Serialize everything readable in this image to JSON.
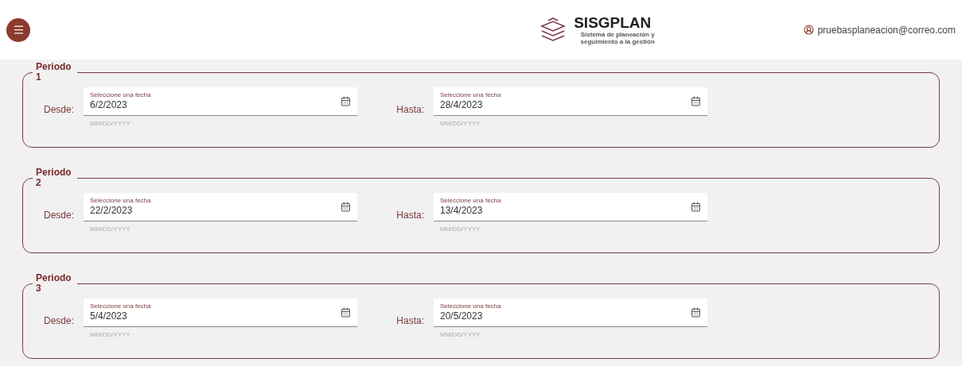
{
  "header": {
    "app_name": "SISGPLAN",
    "app_subtitle": "Sistema de planeación y seguimiento a la gestión",
    "user_email": "pruebasplaneacion@correo.com"
  },
  "periods": [
    {
      "legend": "Periodo 1",
      "from": {
        "label": "Desde:",
        "floating_label": "Seleccione una fecha",
        "value": "6/2/2023",
        "helper": "MM/DD/YYYY"
      },
      "to": {
        "label": "Hasta:",
        "floating_label": "Seleccione una fecha",
        "value": "28/4/2023",
        "helper": "MM/DD/YYYY"
      }
    },
    {
      "legend": "Periodo 2",
      "from": {
        "label": "Desde:",
        "floating_label": "Seleccione una fecha",
        "value": "22/2/2023",
        "helper": "MM/DD/YYYY"
      },
      "to": {
        "label": "Hasta:",
        "floating_label": "Seleccione una fecha",
        "value": "13/4/2023",
        "helper": "MM/DD/YYYY"
      }
    },
    {
      "legend": "Periodo 3",
      "from": {
        "label": "Desde:",
        "floating_label": "Seleccione una fecha",
        "value": "5/4/2023",
        "helper": "MM/DD/YYYY"
      },
      "to": {
        "label": "Hasta:",
        "floating_label": "Seleccione una fecha",
        "value": "20/5/2023",
        "helper": "MM/DD/YYYY"
      }
    }
  ]
}
